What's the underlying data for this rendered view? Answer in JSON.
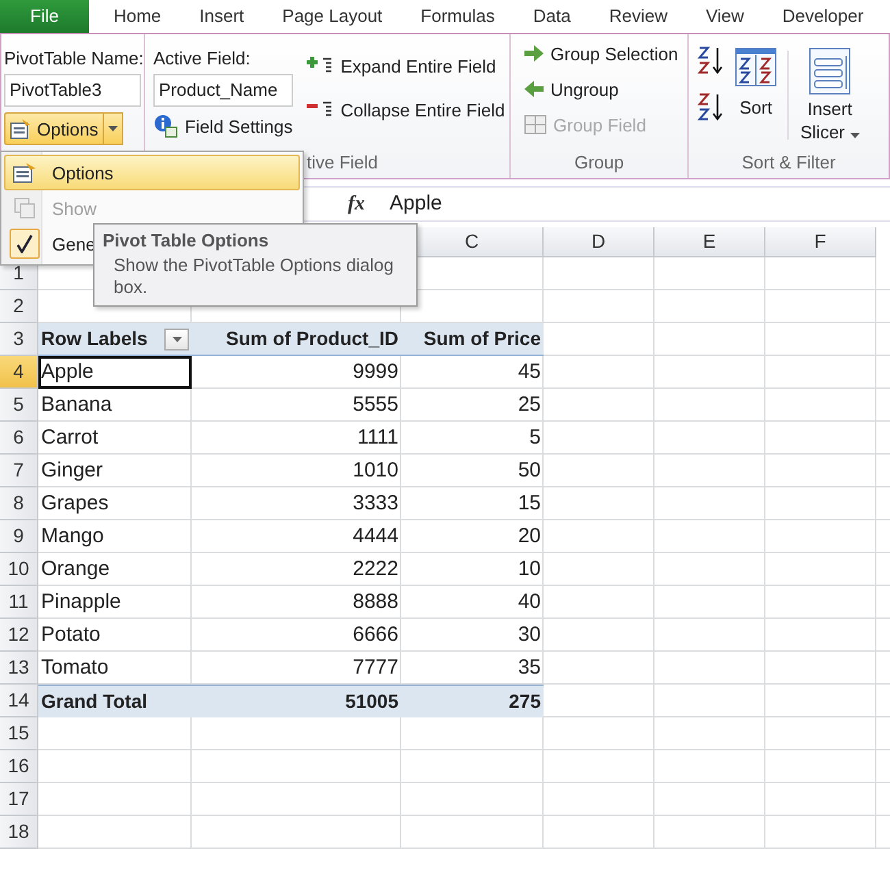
{
  "ribbon_tabs": [
    {
      "label": "File",
      "kind": "file"
    },
    {
      "label": "Home",
      "kind": "tab"
    },
    {
      "label": "Insert",
      "kind": "tab"
    },
    {
      "label": "Page Layout",
      "kind": "tab"
    },
    {
      "label": "Formulas",
      "kind": "tab"
    },
    {
      "label": "Data",
      "kind": "tab"
    },
    {
      "label": "Review",
      "kind": "tab"
    },
    {
      "label": "View",
      "kind": "tab"
    },
    {
      "label": "Developer",
      "kind": "tab"
    }
  ],
  "ribbon": {
    "pivottable": {
      "name_label": "PivotTable Name:",
      "name_value": "PivotTable3",
      "options_button": "Options"
    },
    "active_field": {
      "label": "Active Field:",
      "value": "Product_Name",
      "field_settings": "Field Settings",
      "expand": "Expand Entire Field",
      "collapse": "Collapse Entire Field",
      "group_label": "tive Field"
    },
    "group": {
      "items": [
        {
          "label": "Group Selection",
          "kind": "forward",
          "disabled": false
        },
        {
          "label": "Ungroup",
          "kind": "back",
          "disabled": false
        },
        {
          "label": "Group Field",
          "kind": "field",
          "disabled": true
        }
      ],
      "group_label": "Group"
    },
    "sort_filter": {
      "sort": "Sort",
      "insert_slicer": "Insert Slicer",
      "group_label": "Sort & Filter"
    }
  },
  "options_menu": [
    {
      "label": "Options",
      "kind": "options",
      "selected": true,
      "disabled": false
    },
    {
      "label": "Show",
      "kind": "pages",
      "selected": false,
      "disabled": true
    },
    {
      "label": "Gene",
      "kind": "check",
      "selected": false,
      "disabled": false,
      "checked": true
    }
  ],
  "tooltip": {
    "title": "Pivot Table Options",
    "text": "Show the PivotTable Options dialog box."
  },
  "formula_bar": {
    "function_symbol": "fx",
    "value": "Apple"
  },
  "sheet": {
    "column_headers": [
      "C",
      "D",
      "E",
      "F"
    ],
    "row_numbers": [
      "1",
      "2",
      "3",
      "4",
      "5",
      "6",
      "7",
      "8",
      "9",
      "10",
      "11",
      "12",
      "13",
      "14",
      "15",
      "16",
      "17",
      "18"
    ],
    "pivot": {
      "headers": [
        "Row Labels",
        "Sum of Product_ID",
        "Sum of Price"
      ],
      "rows": [
        {
          "label": "Apple",
          "product_id": "9999",
          "price": "45",
          "selected": true
        },
        {
          "label": "Banana",
          "product_id": "5555",
          "price": "25",
          "selected": false
        },
        {
          "label": "Carrot",
          "product_id": "1111",
          "price": "5",
          "selected": false
        },
        {
          "label": "Ginger",
          "product_id": "1010",
          "price": "50",
          "selected": false
        },
        {
          "label": "Grapes",
          "product_id": "3333",
          "price": "15",
          "selected": false
        },
        {
          "label": "Mango",
          "product_id": "4444",
          "price": "20",
          "selected": false
        },
        {
          "label": "Orange",
          "product_id": "2222",
          "price": "10",
          "selected": false
        },
        {
          "label": "Pinapple",
          "product_id": "8888",
          "price": "40",
          "selected": false
        },
        {
          "label": "Potato",
          "product_id": "6666",
          "price": "30",
          "selected": false
        },
        {
          "label": "Tomato",
          "product_id": "7777",
          "price": "35",
          "selected": false
        }
      ],
      "total": {
        "label": "Grand Total",
        "product_id": "51005",
        "price": "275"
      }
    }
  }
}
